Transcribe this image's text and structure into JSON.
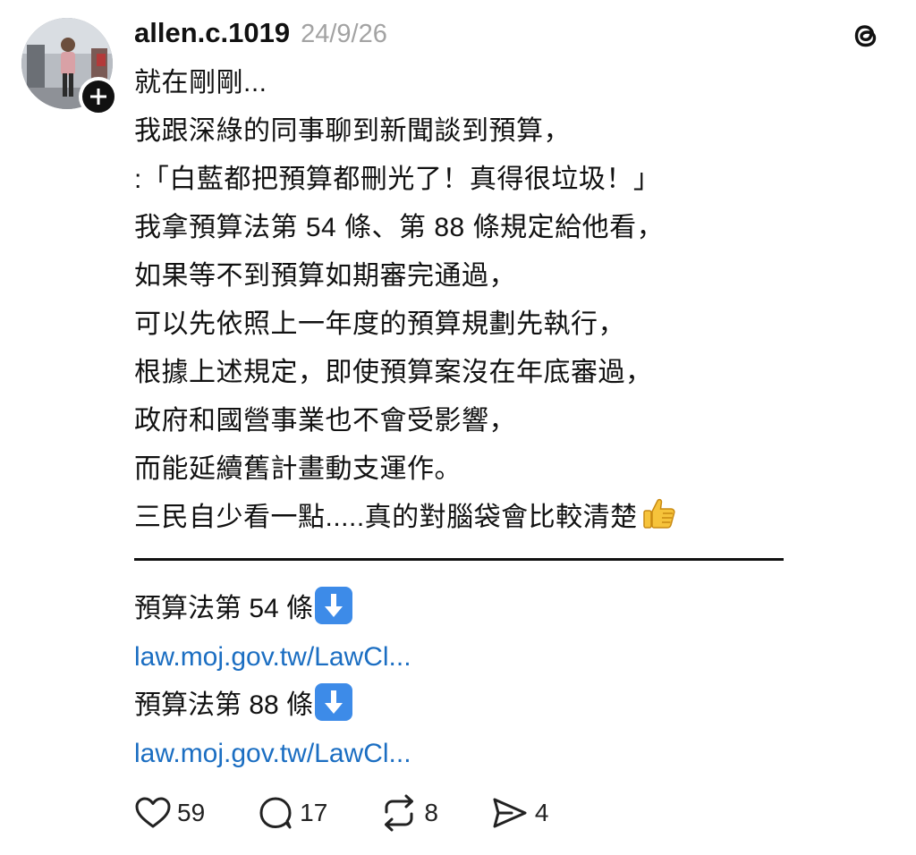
{
  "post": {
    "username": "allen.c.1019",
    "timestamp": "24/9/26",
    "lines": [
      "就在剛剛...",
      "我跟深綠的同事聊到新聞談到預算，",
      ":「白藍都把預算都刪光了！真得很垃圾！」",
      "我拿預算法第 54 條、第 88 條規定給他看，",
      "如果等不到預算如期審完通過，",
      "可以先依照上一年度的預算規劃先執行，",
      "根據上述規定，即使預算案沒在年底審過，",
      "政府和國營事業也不會受影響，",
      "而能延續舊計畫動支運作。",
      "三民自少看一點.....真的對腦袋會比較清楚"
    ],
    "links": [
      {
        "label": "預算法第 54 條",
        "url": "law.moj.gov.tw/LawCl..."
      },
      {
        "label": "預算法第 88 條",
        "url": "law.moj.gov.tw/LawCl..."
      }
    ]
  },
  "actions": {
    "likes": "59",
    "replies": "17",
    "reposts": "8",
    "shares": "4"
  },
  "icons": {
    "avatar": "avatar-photo",
    "follow": "plus-icon",
    "app": "threads-logo-icon",
    "emoji": "thumbs-up-emoji-icon",
    "link_arrow": "down-arrow-emoji-icon",
    "like": "heart-icon",
    "reply": "comment-bubble-icon",
    "repost": "repost-icon",
    "share": "send-icon"
  },
  "colors": {
    "link": "#1b6ec2",
    "timestamp": "#a3a3a3",
    "text": "#111111"
  }
}
